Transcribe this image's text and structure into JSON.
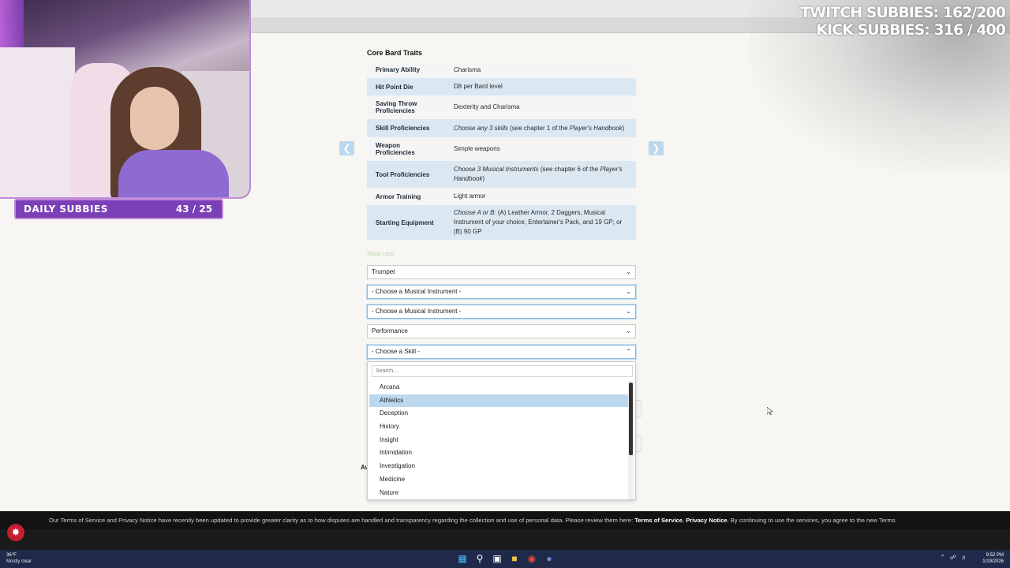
{
  "overlay": {
    "twitch_subs": "TWITCH SUBBIES: 162/200",
    "kick_subs": "KICK SUBBIES: 316 / 400",
    "daily_label": "DAILY SUBBIES",
    "daily_value": "43 / 25"
  },
  "section": {
    "title": "Core Bard Traits",
    "traits": [
      {
        "label": "Primary Ability",
        "value": "Charisma"
      },
      {
        "label": "Hit Point Die",
        "value": "D8 per Bard level"
      },
      {
        "label": "Saving Throw Proficiencies",
        "value": "Dexterity and Charisma"
      },
      {
        "label": "Skill Proficiencies",
        "value_italic": "Choose any 3 skills",
        "value_rest": " (see chapter 1 of the ",
        "value_italic2": "Player's Handbook",
        "value_end": ")"
      },
      {
        "label": "Weapon Proficiencies",
        "value": "Simple weapons"
      },
      {
        "label": "Tool Proficiencies",
        "value_italic": "Choose 3 Musical Instruments",
        "value_rest": " (see chapter 6 of the ",
        "value_italic2": "Player's Handbook",
        "value_end": ")"
      },
      {
        "label": "Armor Training",
        "value": "Light armor"
      },
      {
        "label": "Starting Equipment",
        "value_italic": "Choose A or B:",
        "value_rest": " (A) Leather Armor, 2 Daggers, Musical Instrument of your choice, Entertainer's Pack, and 19 GP; or (B) 90 GP"
      }
    ],
    "show_less": "Show Less"
  },
  "selects": {
    "s1": "Trumpet",
    "s2": "- Choose a Musical Instrument -",
    "s3": "- Choose a Musical Instrument -",
    "s4": "Performance",
    "s5": "- Choose a Skill -"
  },
  "dropdown": {
    "search_placeholder": "Search...",
    "options": [
      "Arcana",
      "Athletics",
      "Deception",
      "History",
      "Insight",
      "Intimidation",
      "Investigation",
      "Medicine",
      "Nature"
    ],
    "highlighted": "Athletics"
  },
  "ghost": {
    "av": "Av"
  },
  "terms": {
    "text": "Our Terms of Service and Privacy Notice have recently been updated to provide greater clarity as to how disputes are handled and transparency regarding the collection and use of personal data. Please review them here: ",
    "tos": "Terms of Service",
    "sep": ", ",
    "privacy": "Privacy Notice",
    "end": ". By continuing to use the services, you agree to the new Terms."
  },
  "taskbar": {
    "temp": "36°F",
    "weather": "Mostly clear",
    "time": "9:52 PM",
    "date": "1/19/2026"
  },
  "icons": {
    "prev": "chevron-left-icon",
    "next": "chevron-right-icon",
    "chevron": "chevron-down-icon",
    "chevron_up": "chevron-up-icon"
  }
}
